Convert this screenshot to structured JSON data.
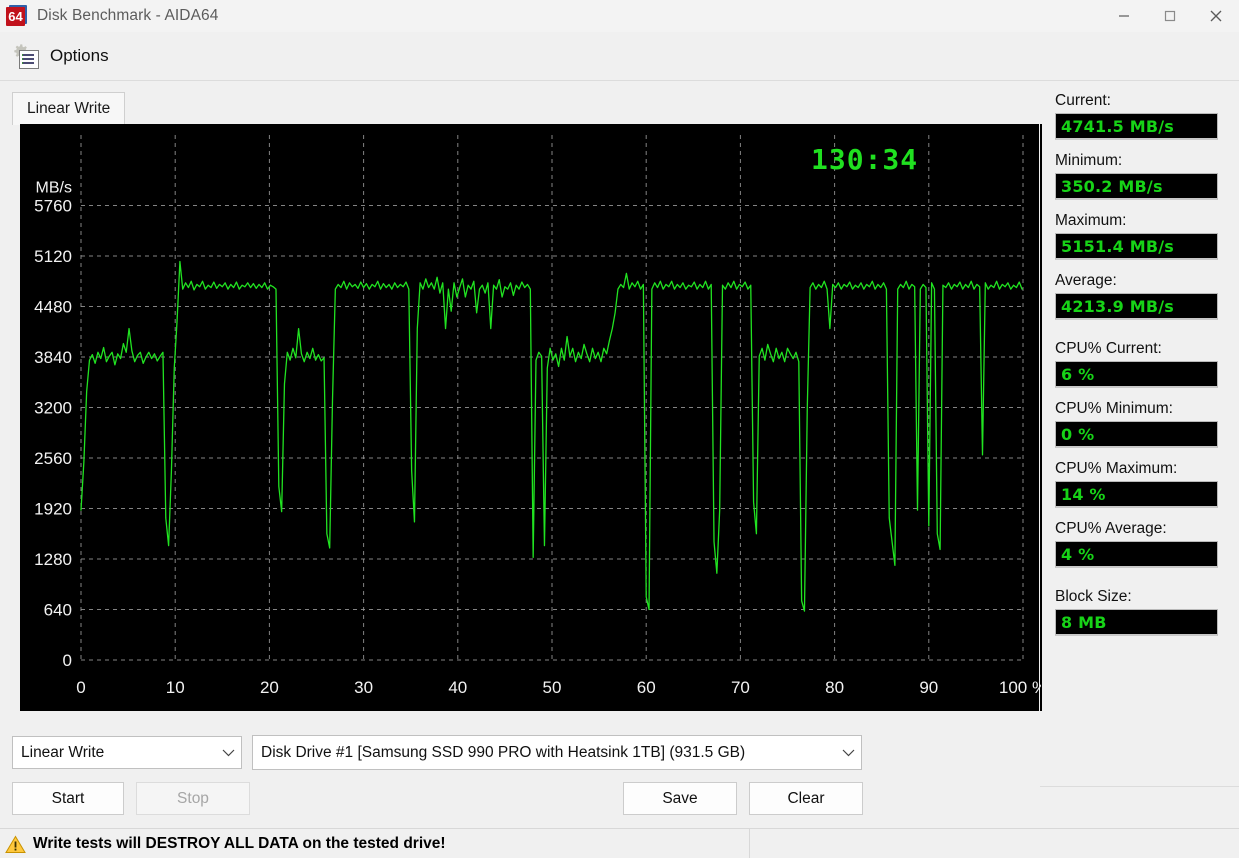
{
  "window": {
    "title": "Disk Benchmark - AIDA64",
    "icon_label": "64",
    "minimize_label": "Minimize",
    "maximize_label": "Maximize",
    "close_label": "Close"
  },
  "menu": {
    "options_label": "Options"
  },
  "tabs": [
    {
      "label": "Linear Write",
      "active": true
    }
  ],
  "chart": {
    "timer": "130:34",
    "y_axis_title": "MB/s",
    "x_axis_suffix": "%"
  },
  "controls": {
    "test_mode": "Linear Write",
    "drive": "Disk Drive #1  [Samsung SSD 990 PRO with Heatsink 1TB]  (931.5 GB)",
    "start_label": "Start",
    "stop_label": "Stop",
    "stop_disabled": true,
    "save_label": "Save",
    "clear_label": "Clear"
  },
  "warning": {
    "text": "Write tests will DESTROY ALL DATA on the tested drive!",
    "icon": "warning-triangle-icon"
  },
  "sidebar": {
    "stats": [
      {
        "label": "Current:",
        "value": "4741.5 MB/s"
      },
      {
        "label": "Minimum:",
        "value": "350.2 MB/s"
      },
      {
        "label": "Maximum:",
        "value": "5151.4 MB/s"
      },
      {
        "label": "Average:",
        "value": "4213.9 MB/s"
      },
      {
        "label": "CPU% Current:",
        "value": "6 %"
      },
      {
        "label": "CPU% Minimum:",
        "value": "0 %"
      },
      {
        "label": "CPU% Maximum:",
        "value": "14 %"
      },
      {
        "label": "CPU% Average:",
        "value": "4 %"
      },
      {
        "label": "Block Size:",
        "value": "8 MB"
      }
    ]
  },
  "colors": {
    "trace": "#21e321",
    "plot_bg": "#000000",
    "grid": "#9a9a9a",
    "axis_text": "#f2f2f2",
    "value_text": "#17d317",
    "accent_red": "#c1121c"
  },
  "chart_data": {
    "type": "line",
    "title": "Linear Write",
    "xlabel": "%",
    "ylabel": "MB/s",
    "xlim": [
      0,
      100
    ],
    "ylim": [
      0,
      6400
    ],
    "grid": true,
    "legend": false,
    "yticks": [
      0,
      640,
      1280,
      1920,
      2560,
      3200,
      3840,
      4480,
      5120,
      5760
    ],
    "xticks": [
      0,
      10,
      20,
      30,
      40,
      50,
      60,
      70,
      80,
      90,
      100
    ],
    "xtick_labels": [
      "0",
      "10",
      "20",
      "30",
      "40",
      "50",
      "60",
      "70",
      "80",
      "90",
      "100 %"
    ],
    "summary": {
      "current_mbps": 4741.5,
      "minimum_mbps": 350.2,
      "maximum_mbps": 5151.4,
      "average_mbps": 4213.9,
      "cpu_current_pct": 6,
      "cpu_minimum_pct": 0,
      "cpu_maximum_pct": 14,
      "cpu_average_pct": 4,
      "block_size": "8 MB",
      "elapsed": "130:34"
    },
    "series": [
      {
        "name": "Linear Write",
        "color": "#21e321",
        "x": [
          0.0,
          0.3,
          0.6,
          0.9,
          1.2,
          1.5,
          1.8,
          2.1,
          2.4,
          2.7,
          3.0,
          3.3,
          3.6,
          3.9,
          4.2,
          4.5,
          4.8,
          5.1,
          5.4,
          5.7,
          6.0,
          6.3,
          6.6,
          6.9,
          7.2,
          7.5,
          7.8,
          8.1,
          8.4,
          8.7,
          9.0,
          9.3,
          9.6,
          9.9,
          10.2,
          10.5,
          10.8,
          11.1,
          11.4,
          11.7,
          12.0,
          12.3,
          12.6,
          12.9,
          13.2,
          13.5,
          13.8,
          14.1,
          14.4,
          14.7,
          15.0,
          15.3,
          15.6,
          15.9,
          16.2,
          16.5,
          16.8,
          17.1,
          17.4,
          17.7,
          18.0,
          18.3,
          18.6,
          18.9,
          19.2,
          19.5,
          19.8,
          20.1,
          20.4,
          20.7,
          21.0,
          21.3,
          21.6,
          21.9,
          22.2,
          22.5,
          22.8,
          23.1,
          23.4,
          23.7,
          24.0,
          24.3,
          24.6,
          24.9,
          25.2,
          25.5,
          25.8,
          26.1,
          26.4,
          26.7,
          27.0,
          27.3,
          27.6,
          27.9,
          28.2,
          28.5,
          28.8,
          29.1,
          29.4,
          29.7,
          30.0,
          30.3,
          30.6,
          30.9,
          31.2,
          31.5,
          31.8,
          32.1,
          32.4,
          32.7,
          33.0,
          33.3,
          33.6,
          33.9,
          34.2,
          34.5,
          34.8,
          35.1,
          35.4,
          35.7,
          36.0,
          36.3,
          36.6,
          36.9,
          37.2,
          37.5,
          37.8,
          38.1,
          38.4,
          38.7,
          39.0,
          39.3,
          39.6,
          39.9,
          40.2,
          40.5,
          40.8,
          41.1,
          41.4,
          41.7,
          42.0,
          42.3,
          42.6,
          42.9,
          43.2,
          43.5,
          43.8,
          44.1,
          44.4,
          44.7,
          45.0,
          45.3,
          45.6,
          45.9,
          46.2,
          46.5,
          46.8,
          47.1,
          47.4,
          47.7,
          48.0,
          48.3,
          48.6,
          48.9,
          49.2,
          49.5,
          49.8,
          50.1,
          50.4,
          50.7,
          51.0,
          51.3,
          51.6,
          51.9,
          52.2,
          52.5,
          52.8,
          53.1,
          53.4,
          53.7,
          54.0,
          54.3,
          54.6,
          54.9,
          55.2,
          55.5,
          55.8,
          56.1,
          56.4,
          56.7,
          57.0,
          57.3,
          57.6,
          57.9,
          58.2,
          58.5,
          58.8,
          59.1,
          59.4,
          59.7,
          60.0,
          60.3,
          60.6,
          60.9,
          61.2,
          61.5,
          61.8,
          62.1,
          62.4,
          62.7,
          63.0,
          63.3,
          63.6,
          63.9,
          64.2,
          64.5,
          64.8,
          65.1,
          65.4,
          65.7,
          66.0,
          66.3,
          66.6,
          66.9,
          67.2,
          67.5,
          67.8,
          68.1,
          68.4,
          68.7,
          69.0,
          69.3,
          69.6,
          69.9,
          70.2,
          70.5,
          70.8,
          71.1,
          71.4,
          71.7,
          72.0,
          72.3,
          72.6,
          72.9,
          73.2,
          73.5,
          73.8,
          74.1,
          74.4,
          74.7,
          75.0,
          75.3,
          75.6,
          75.9,
          76.2,
          76.5,
          76.8,
          77.1,
          77.4,
          77.7,
          78.0,
          78.3,
          78.6,
          78.9,
          79.2,
          79.5,
          79.8,
          80.1,
          80.4,
          80.7,
          81.0,
          81.3,
          81.6,
          81.9,
          82.2,
          82.5,
          82.8,
          83.1,
          83.4,
          83.7,
          84.0,
          84.3,
          84.6,
          84.9,
          85.2,
          85.5,
          85.8,
          86.1,
          86.4,
          86.7,
          87.0,
          87.3,
          87.6,
          87.9,
          88.2,
          88.5,
          88.8,
          89.1,
          89.4,
          89.7,
          90.0,
          90.3,
          90.6,
          90.9,
          91.2,
          91.5,
          91.8,
          92.1,
          92.4,
          92.7,
          93.0,
          93.3,
          93.6,
          93.9,
          94.2,
          94.5,
          94.8,
          95.1,
          95.4,
          95.7,
          96.0,
          96.3,
          96.6,
          96.9,
          97.2,
          97.5,
          97.8,
          98.1,
          98.4,
          98.7,
          99.0,
          99.3,
          99.6,
          99.9
        ],
        "y": [
          1900,
          2500,
          3400,
          3800,
          3870,
          3760,
          3900,
          3820,
          3960,
          3780,
          3850,
          3900,
          3740,
          3880,
          3820,
          4010,
          3900,
          4200,
          3920,
          3780,
          3860,
          3900,
          3760,
          3840,
          3900,
          3820,
          3880,
          3790,
          3850,
          3900,
          1800,
          1450,
          2400,
          3700,
          4300,
          5050,
          4700,
          4780,
          4720,
          4800,
          4690,
          4760,
          4730,
          4800,
          4700,
          4750,
          4720,
          4790,
          4710,
          4760,
          4730,
          4780,
          4700,
          4760,
          4720,
          4790,
          4700,
          4750,
          4730,
          4780,
          4720,
          4770,
          4710,
          4760,
          4720,
          4780,
          4700,
          4750,
          4730,
          4700,
          2200,
          1880,
          3500,
          3900,
          3800,
          3950,
          3830,
          4200,
          3880,
          3780,
          3900,
          3820,
          3950,
          3800,
          3870,
          3790,
          3830,
          1600,
          1420,
          3300,
          4700,
          4760,
          4720,
          4800,
          4700,
          4780,
          4730,
          4760,
          4710,
          4790,
          4720,
          4770,
          4700,
          4760,
          4730,
          4800,
          4700,
          4770,
          4720,
          4760,
          4700,
          4780,
          4720,
          4760,
          4730,
          4790,
          4700,
          2400,
          1750,
          4200,
          4780,
          4700,
          4830,
          4720,
          4780,
          4700,
          4850,
          4650,
          4780,
          4200,
          4700,
          4420,
          4780,
          4600,
          4720,
          4830,
          4600,
          4750,
          4700,
          4800,
          4400,
          4700,
          4750,
          4650,
          4780,
          4200,
          4750,
          4700,
          4820,
          4600,
          4730,
          4700,
          4780,
          4620,
          4750,
          4700,
          4790,
          4720,
          4760,
          4700,
          1300,
          3800,
          3900,
          3850,
          1450,
          3700,
          3950,
          3800,
          3880,
          3720,
          3950,
          3800,
          4100,
          3850,
          3950,
          3780,
          3900,
          3820,
          4000,
          3880,
          3780,
          3950,
          3820,
          3900,
          3780,
          3950,
          3880,
          4050,
          4200,
          4400,
          4700,
          4760,
          4720,
          4900,
          4700,
          4780,
          4730,
          4800,
          4700,
          4760,
          800,
          640,
          4700,
          4780,
          4720,
          4800,
          4700,
          4760,
          4730,
          4800,
          4700,
          4760,
          4720,
          4780,
          4700,
          4750,
          4730,
          4790,
          4700,
          4760,
          4720,
          4800,
          4700,
          4760,
          1500,
          1100,
          1900,
          4750,
          4700,
          4780,
          4720,
          4800,
          4700,
          4760,
          4730,
          4790,
          4700,
          4750,
          2000,
          1600,
          3850,
          3950,
          3800,
          4000,
          3880,
          3780,
          3950,
          3820,
          3900,
          3780,
          3950,
          3880,
          3820,
          3900,
          3780,
          750,
          620,
          3200,
          4720,
          4780,
          4700,
          4760,
          4720,
          4800,
          4700,
          4200,
          4760,
          4720,
          4780,
          4700,
          4760,
          4730,
          4790,
          4700,
          4750,
          4720,
          4780,
          4700,
          4760,
          4730,
          4800,
          4700,
          4760,
          4720,
          4780,
          4700,
          1800,
          1500,
          1200,
          4700,
          4760,
          4720,
          4800,
          4700,
          4760,
          4730,
          1900,
          4700,
          4760,
          4720,
          1700,
          4780,
          4700,
          1600,
          1400,
          4750,
          4720,
          4780,
          4700,
          4760,
          4730,
          4790,
          4700,
          4760,
          4720,
          4800,
          4700,
          4760,
          4730,
          2600,
          4780,
          4700,
          4750,
          4720,
          4800,
          4700,
          4760,
          4730,
          4780,
          4700,
          4750,
          4720,
          4790,
          4700,
          3800,
          4760,
          4720,
          4800,
          4700,
          4760,
          4730,
          4780,
          4700,
          4760,
          4720,
          4850,
          4700,
          4760
        ]
      }
    ]
  }
}
